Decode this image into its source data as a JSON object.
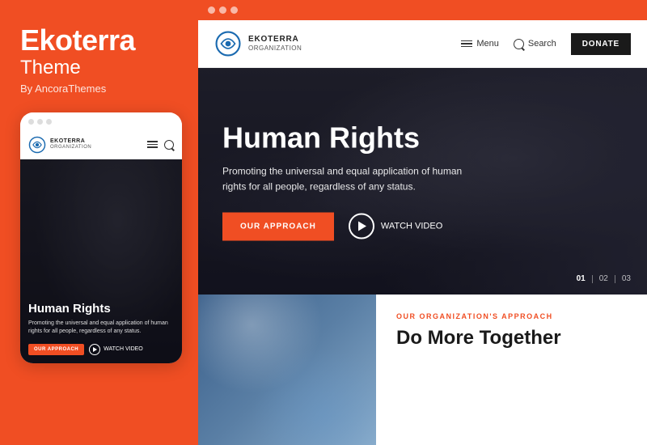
{
  "left": {
    "brand_title": "Ekoterra",
    "brand_subtitle": "Theme",
    "brand_by": "By AncoraThemes"
  },
  "mobile": {
    "dots": [
      "dot1",
      "dot2",
      "dot3"
    ],
    "org_name": "EKOTERRA",
    "org_sub": "ORGANIZATION",
    "hero_title": "Human Rights",
    "hero_desc": "Promoting the universal and equal application of human rights for all people, regardless of any status.",
    "btn_approach": "OUR APPROACH",
    "btn_watch": "WATCH VIDEO"
  },
  "desktop": {
    "browser_dots": [
      "d1",
      "d2",
      "d3"
    ],
    "nav": {
      "org_name": "EKOTERRA",
      "org_sub": "ORGANIZATION",
      "menu_label": "Menu",
      "search_label": "Search",
      "donate_label": "DONATE"
    },
    "hero": {
      "title": "Human Rights",
      "desc": "Promoting the universal and equal application of human rights for all people, regardless of any status.",
      "btn_approach": "OUR APPROACH",
      "btn_watch": "WATCH VIDEO"
    },
    "slides": {
      "current": "01",
      "total_2": "02",
      "total_3": "03"
    },
    "bottom": {
      "label": "OUR ORGANIZATION'S APPROACH",
      "heading": "Do More Together"
    }
  }
}
